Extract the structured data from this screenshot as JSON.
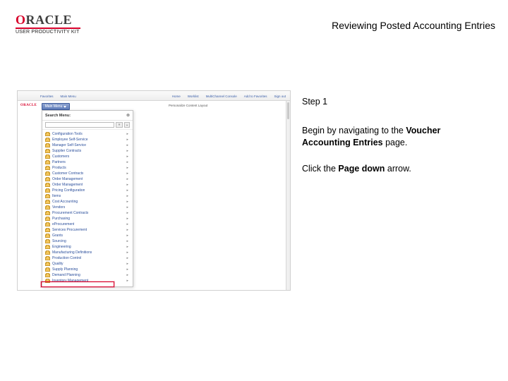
{
  "header": {
    "logo_o": "O",
    "logo_rest": "RACLE",
    "upk": "USER PRODUCTIVITY KIT"
  },
  "title": "Reviewing Posted Accounting Entries",
  "instructions": {
    "step_label": "Step 1",
    "intro_1": "Begin by navigating to the ",
    "intro_bold": "Voucher Accounting Entries",
    "intro_2": " page.",
    "click_1": "Click the ",
    "click_bold": "Page down",
    "click_2": " arrow."
  },
  "app": {
    "nav": {
      "favorites": "Favorites",
      "main_menu": "Main Menu",
      "home": "Home",
      "worklist": "Worklist",
      "mcs": "MultiChannel Console",
      "atf": "Add to Favorites",
      "signout": "Sign out"
    },
    "main_menu_btn": "Main Menu",
    "breadcrumb": "Personalize Content  Layout",
    "menu_title": "Search Menu:",
    "search_placeholder": "",
    "go": "»",
    "adv": "⌄",
    "items": [
      {
        "label": "Configuration Tools",
        "sub": true
      },
      {
        "label": "Employee Self-Service",
        "sub": true
      },
      {
        "label": "Manager Self-Service",
        "sub": true
      },
      {
        "label": "Supplier Contracts",
        "sub": true
      },
      {
        "label": "Customers",
        "sub": true
      },
      {
        "label": "Partners",
        "sub": true
      },
      {
        "label": "Products",
        "sub": true
      },
      {
        "label": "Customer Contracts",
        "sub": true
      },
      {
        "label": "Order Management",
        "sub": true
      },
      {
        "label": "Order Management",
        "sub": true
      },
      {
        "label": "Pricing Configuration",
        "sub": true
      },
      {
        "label": "Items",
        "sub": true
      },
      {
        "label": "Cost Accounting",
        "sub": true
      },
      {
        "label": "Vendors",
        "sub": true
      },
      {
        "label": "Procurement Contracts",
        "sub": true
      },
      {
        "label": "Purchasing",
        "sub": true
      },
      {
        "label": "eProcurement",
        "sub": true
      },
      {
        "label": "Services Procurement",
        "sub": true
      },
      {
        "label": "Grants",
        "sub": true
      },
      {
        "label": "Sourcing",
        "sub": true
      },
      {
        "label": "Engineering",
        "sub": true
      },
      {
        "label": "Manufacturing Definitions",
        "sub": true
      },
      {
        "label": "Production Control",
        "sub": true
      },
      {
        "label": "Quality",
        "sub": true
      },
      {
        "label": "Supply Planning",
        "sub": true
      },
      {
        "label": "Demand Planning",
        "sub": true
      },
      {
        "label": "Inventory Management",
        "sub": true
      }
    ]
  }
}
